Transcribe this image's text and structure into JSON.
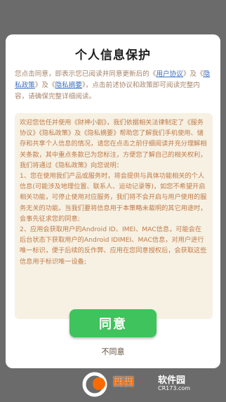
{
  "dialog": {
    "title": "个人信息保护",
    "intro": {
      "part1": "您点击同意，即表示您已阅读并同意更新后的《",
      "link_user": "用户协议",
      "part2": "》及《",
      "link_privacy": "隐私政策",
      "part3": "》及《",
      "link_summary": "隐私摘要",
      "part4": "》，点击前述协议和政策即可阅读完整内容，请确保完整详细阅读。"
    },
    "content": [
      "欢迎您信任并使用《财神小剧》，我们依据相关法律制定了《服务协议》《隐私政策》及《隐私摘要》帮助您了解我们手机使用、储存和共享个人信息的情况，请您在点击之前仔细阅读并充分理解相关条款，其中重点条款已为您标注，方便您了解自己的相关权利，我们将通过《隐私政策》向您说明：",
      "1、您在使用我们产品或服务时，将会提供与具体功能相关的个人信息(可能涉及地理位置、联系人、运动记录等)，如您不希望开启相关功能，可停止使用对应服务，我们将不会开启与用户使用的服务无关的功能。当我们要将信息用于本策略未载明的其它用途时，会事先征求您的同意;",
      "2、应用会获取用户的Android ID、IMEI、MAC信息，可能会在后台状态下获取用户的Android IDIMEI、MAC信息，对用户进行唯一标识，便于后续的反作弊、应用在您同意授权后，会获取这些信息用于标识唯一设备;"
    ],
    "agree_label": "同意",
    "disagree_label": "不同意"
  },
  "watermark": {
    "brand": "西西",
    "sub": "软件园",
    "url": "CR173.com"
  },
  "colors": {
    "accent_green": "#3fc35c",
    "link_blue": "#3b6fc4",
    "body_text": "#c07a48",
    "content_bg": "#f7f1e3"
  }
}
